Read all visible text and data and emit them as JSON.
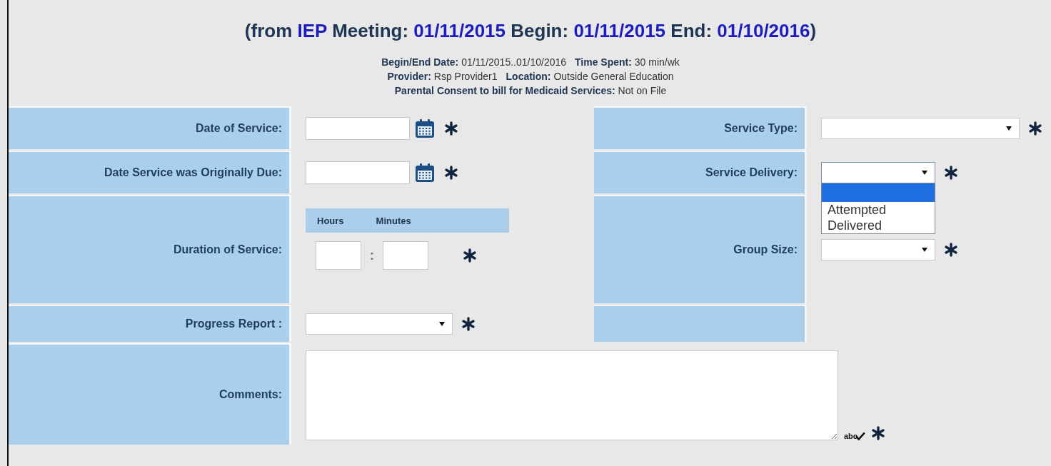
{
  "title": [
    {
      "kind": "label",
      "text": "(from"
    },
    {
      "kind": "value",
      "text": "IEP"
    },
    {
      "kind": "label",
      "text": "Meeting:"
    },
    {
      "kind": "value",
      "text": "01/11/2015"
    },
    {
      "kind": "label",
      "text": "Begin:"
    },
    {
      "kind": "value",
      "text": "01/11/2015"
    },
    {
      "kind": "label",
      "text": "End:"
    },
    {
      "kind": "value",
      "text": "01/10/2016"
    },
    {
      "kind": "label",
      "text": ")"
    }
  ],
  "details": [
    [
      {
        "label": "Begin/End Date:",
        "value": "01/11/2015..01/10/2016"
      },
      {
        "label": "Time Spent:",
        "value": "30 min/wk"
      }
    ],
    [
      {
        "label": "Provider:",
        "value": "Rsp Provider1"
      },
      {
        "label": "Location:",
        "value": "Outside General Education"
      }
    ],
    [
      {
        "label": "Parental Consent to bill for Medicaid Services:",
        "value": "Not on File"
      }
    ]
  ],
  "rows": [
    {
      "left": {
        "label": "Date of Service:",
        "kind": "date",
        "required": true
      },
      "right": {
        "label": "Service Type:",
        "kind": "select",
        "required": true
      }
    },
    {
      "left": {
        "label": "Date Service was Originally Due:",
        "kind": "date",
        "required": true
      },
      "right": {
        "label": "Service Delivery:",
        "kind": "select",
        "required": true,
        "expanded": true,
        "options": [
          {
            "selected": true
          },
          {
            "text": "Attempted",
            "selected": false
          },
          {
            "text": "Delivered",
            "selected": false
          }
        ]
      }
    },
    {
      "left": {
        "label": "Duration of Service:",
        "kind": "duration",
        "required": true,
        "hours_label": "Hours",
        "minutes_label": "Minutes",
        "separator": ":"
      },
      "right": {
        "label": "Group Size:",
        "kind": "select",
        "required": true
      }
    },
    {
      "left": {
        "label": "Progress Report :",
        "kind": "select",
        "required": true
      },
      "right": {
        "kind": "empty"
      }
    },
    {
      "left": {
        "label": "Comments:",
        "kind": "textarea",
        "required": true,
        "spellcheck_label": "abc"
      }
    }
  ]
}
